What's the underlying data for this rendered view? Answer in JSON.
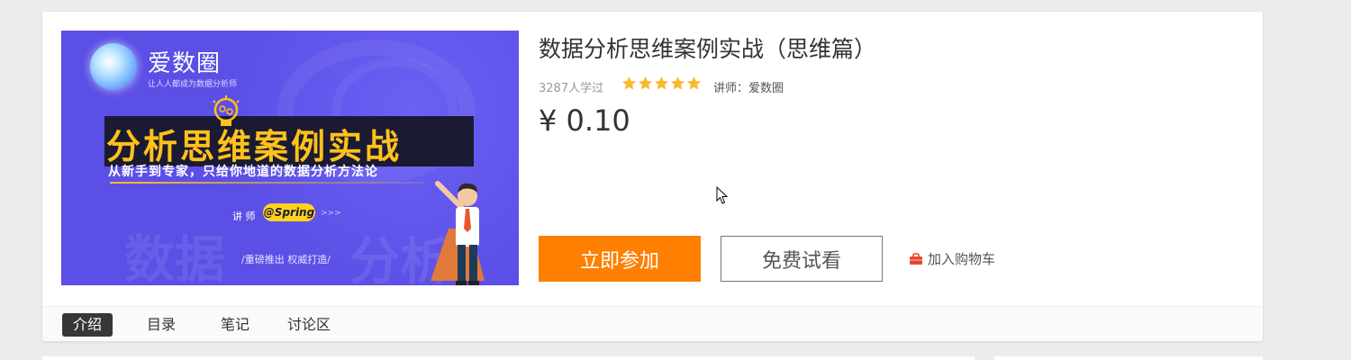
{
  "banner": {
    "logo_name": "爱数圈",
    "logo_slogan": "让人人都成为数据分析师",
    "title": "分析思维案例实战",
    "subtitle": "从新手到专家，只给你地道的数据分析方法论",
    "lecturer_label": "讲 师",
    "lecturer_badge": "@Spring",
    "arrows": ">>>",
    "watermark_left": "数据",
    "watermark_right": "分析",
    "tagline": "/重磅推出  权威打造/"
  },
  "course": {
    "title": "数据分析思维案例实战（思维篇）",
    "learned": "3287人学过",
    "rating": 5,
    "lecturer": "讲师：爱数圈",
    "price": "¥ 0.10"
  },
  "actions": {
    "join_label": "立即参加",
    "free_label": "免费试看",
    "cart_label": "加入购物车"
  },
  "tabs": [
    {
      "label": "介绍",
      "active": true
    },
    {
      "label": "目录",
      "active": false
    },
    {
      "label": "笔记",
      "active": false
    },
    {
      "label": "讨论区",
      "active": false
    }
  ],
  "colors": {
    "accent_orange": "#ff7f00",
    "banner_purple": "#5b4fe6",
    "star_gold": "#f7ba2a",
    "title_yellow": "#ffc21a"
  }
}
